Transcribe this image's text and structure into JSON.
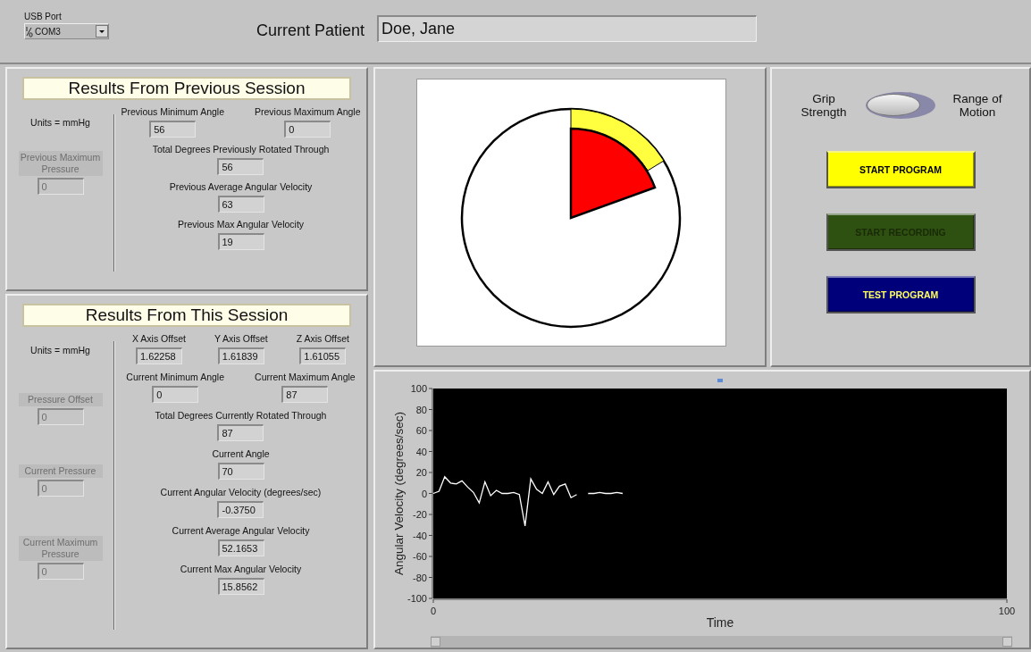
{
  "usb_port": {
    "label": "USB Port",
    "value": "COM3"
  },
  "patient": {
    "label": "Current Patient",
    "value": "Doe, Jane"
  },
  "previous_session": {
    "title": "Results From Previous Session",
    "units": "Units = mmHg",
    "side_fields": [
      {
        "label": "Previous Maximum Pressure",
        "value": "0",
        "disabled": true
      }
    ],
    "field_rows": [
      [
        {
          "label": "Previous Minimum Angle",
          "value": "56",
          "disabled": false
        },
        {
          "label": "Previous Maximum Angle",
          "value": "0",
          "disabled": false
        }
      ],
      [
        {
          "label": "Total Degrees Previously Rotated Through",
          "value": "56",
          "disabled": false
        }
      ],
      [
        {
          "label": "Previous Average Angular Velocity",
          "value": "63",
          "disabled": false
        }
      ],
      [
        {
          "label": "Previous Max Angular Velocity",
          "value": "19",
          "disabled": false
        }
      ]
    ]
  },
  "this_session": {
    "title": "Results From This Session",
    "units": "Units = mmHg",
    "side_fields": [
      {
        "label": "Pressure  Offset",
        "value": "0",
        "disabled": true
      },
      {
        "label": "Current Pressure",
        "value": "0",
        "disabled": true
      },
      {
        "label": "Current Maximum Pressure",
        "value": "0",
        "disabled": true
      }
    ],
    "field_rows": [
      [
        {
          "label": "X Axis Offset",
          "value": "1.62258",
          "disabled": false
        },
        {
          "label": "Y Axis Offset",
          "value": "1.61839",
          "disabled": false
        },
        {
          "label": "Z Axis Offset",
          "value": "1.61055",
          "disabled": false
        }
      ],
      [
        {
          "label": "Current Minimum Angle",
          "value": "0",
          "disabled": false
        },
        {
          "label": "Current Maximum Angle",
          "value": "87",
          "disabled": false
        }
      ],
      [
        {
          "label": "Total Degrees Currently Rotated Through",
          "value": "87",
          "disabled": false
        }
      ],
      [
        {
          "label": "Current Angle",
          "value": "70",
          "disabled": false
        }
      ],
      [
        {
          "label": "Current Angular Velocity (degrees/sec)",
          "value": "-0.3750",
          "disabled": false
        }
      ],
      [
        {
          "label": "Current Average Angular Velocity",
          "value": "52.1653",
          "disabled": false
        }
      ],
      [
        {
          "label": "Current Max Angular Velocity",
          "value": "15.8562",
          "disabled": false
        }
      ]
    ]
  },
  "mode_switch": {
    "left_label": "Grip Strength",
    "right_label": "Range of Motion",
    "on": false
  },
  "buttons": [
    {
      "label": "START PROGRAM",
      "color": "#ffff00",
      "disabled": false
    },
    {
      "label": "START RECORDING",
      "color": "#2e5010",
      "disabled": true
    },
    {
      "label": "TEST PROGRAM",
      "color": "#00007a",
      "disabled": false
    }
  ],
  "velocity_graph": {
    "chart_data": {
      "type": "line",
      "xlabel": "Time",
      "ylabel": "Angular Velocity (degrees/sec)",
      "x": [
        0,
        1,
        2,
        3,
        4,
        5,
        6,
        7,
        8,
        9,
        10,
        11,
        12,
        13,
        14,
        15,
        16,
        17,
        18,
        19,
        20,
        21,
        22,
        23,
        24,
        25,
        27,
        28,
        29,
        30,
        31,
        32,
        33
      ],
      "series": [
        {
          "color": "#ffffff",
          "values": [
            0,
            2,
            16,
            10,
            9,
            12,
            6,
            1,
            -9,
            11,
            -2,
            3,
            0,
            0,
            1,
            -1,
            -31,
            14,
            4,
            0,
            11,
            -1,
            7,
            9,
            -4,
            -1,
            0,
            0,
            1,
            0,
            0,
            1,
            0
          ]
        }
      ],
      "xlim": [
        0,
        100
      ],
      "ylim": [
        -100,
        100
      ],
      "xticks": [
        0,
        100
      ],
      "yticks": [
        -100,
        -80,
        -60,
        -40,
        -20,
        0,
        20,
        40,
        60,
        80,
        100
      ]
    }
  }
}
